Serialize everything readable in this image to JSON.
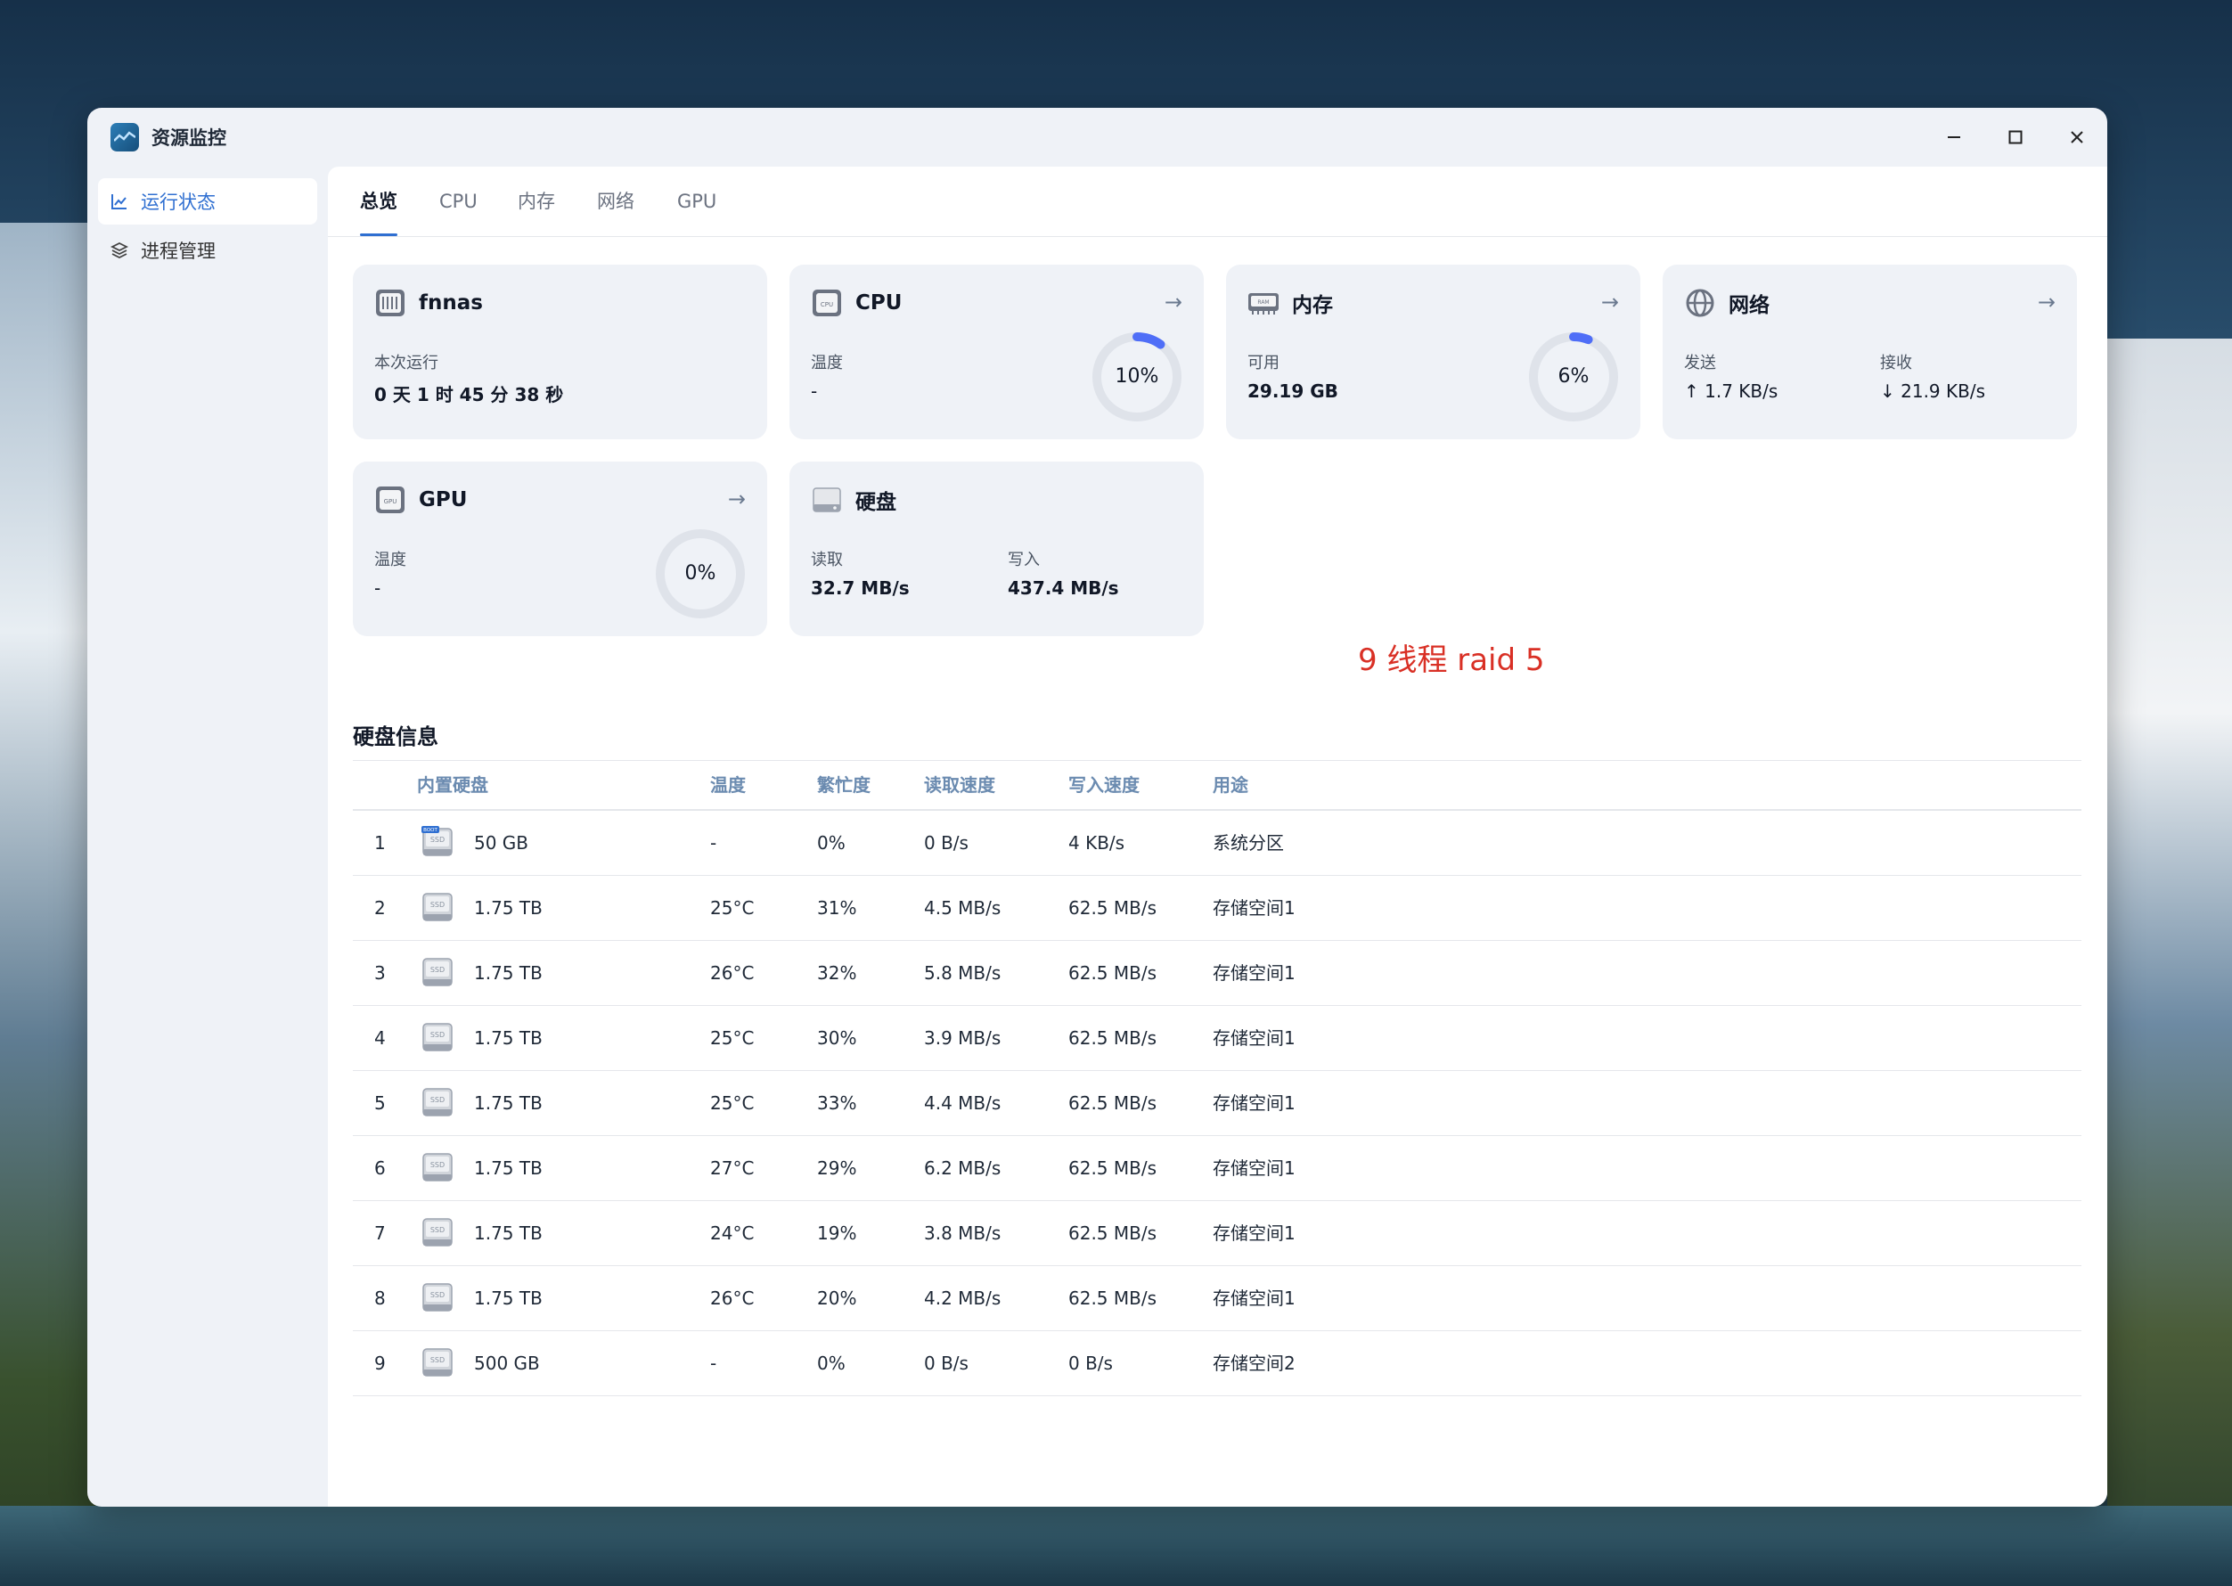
{
  "app": {
    "title": "资源监控"
  },
  "window_controls": {
    "minimize": "—",
    "maximize": "☐",
    "close": "✕"
  },
  "sidebar": {
    "items": [
      {
        "label": "运行状态",
        "active": true,
        "icon": "line-chart-icon"
      },
      {
        "label": "进程管理",
        "active": false,
        "icon": "layers-icon"
      }
    ]
  },
  "tabs": [
    {
      "label": "总览",
      "active": true
    },
    {
      "label": "CPU",
      "active": false
    },
    {
      "label": "内存",
      "active": false
    },
    {
      "label": "网络",
      "active": false
    },
    {
      "label": "GPU",
      "active": false
    }
  ],
  "cards": {
    "system": {
      "title": "fnnas",
      "uptime_label": "本次运行",
      "uptime_value": "0 天 1 时 45 分 38 秒"
    },
    "cpu": {
      "title": "CPU",
      "temp_label": "温度",
      "temp_value": "-",
      "usage_text": "10%",
      "usage": 0.1
    },
    "memory": {
      "title": "内存",
      "avail_label": "可用",
      "avail_value": "29.19 GB",
      "usage_text": "6%",
      "usage": 0.06
    },
    "network": {
      "title": "网络",
      "send_label": "发送",
      "send_value": "↑ 1.7 KB/s",
      "recv_label": "接收",
      "recv_value": "↓ 21.9 KB/s"
    },
    "gpu": {
      "title": "GPU",
      "temp_label": "温度",
      "temp_value": "-",
      "usage_text": "0%",
      "usage": 0.0
    },
    "disk": {
      "title": "硬盘",
      "read_label": "读取",
      "read_value": "32.7 MB/s",
      "write_label": "写入",
      "write_value": "437.4 MB/s"
    }
  },
  "annotation": "9 线程 raid 5",
  "disk_info": {
    "title": "硬盘信息",
    "columns": [
      "内置硬盘",
      "温度",
      "繁忙度",
      "读取速度",
      "写入速度",
      "用途"
    ],
    "rows": [
      {
        "num": "1",
        "badge": "BOOT",
        "size": "50 GB",
        "temp": "-",
        "busy": "0%",
        "read": "0 B/s",
        "write": "4 KB/s",
        "use": "系统分区"
      },
      {
        "num": "2",
        "size": "1.75 TB",
        "temp": "25°C",
        "busy": "31%",
        "read": "4.5 MB/s",
        "write": "62.5 MB/s",
        "use": "存储空间1"
      },
      {
        "num": "3",
        "size": "1.75 TB",
        "temp": "26°C",
        "busy": "32%",
        "read": "5.8 MB/s",
        "write": "62.5 MB/s",
        "use": "存储空间1"
      },
      {
        "num": "4",
        "size": "1.75 TB",
        "temp": "25°C",
        "busy": "30%",
        "read": "3.9 MB/s",
        "write": "62.5 MB/s",
        "use": "存储空间1"
      },
      {
        "num": "5",
        "size": "1.75 TB",
        "temp": "25°C",
        "busy": "33%",
        "read": "4.4 MB/s",
        "write": "62.5 MB/s",
        "use": "存储空间1"
      },
      {
        "num": "6",
        "size": "1.75 TB",
        "temp": "27°C",
        "busy": "29%",
        "read": "6.2 MB/s",
        "write": "62.5 MB/s",
        "use": "存储空间1"
      },
      {
        "num": "7",
        "size": "1.75 TB",
        "temp": "24°C",
        "busy": "19%",
        "read": "3.8 MB/s",
        "write": "62.5 MB/s",
        "use": "存储空间1"
      },
      {
        "num": "8",
        "size": "1.75 TB",
        "temp": "26°C",
        "busy": "20%",
        "read": "4.2 MB/s",
        "write": "62.5 MB/s",
        "use": "存储空间1"
      },
      {
        "num": "9",
        "size": "500 GB",
        "temp": "-",
        "busy": "0%",
        "read": "0 B/s",
        "write": "0 B/s",
        "use": "存储空间2"
      }
    ]
  },
  "colors": {
    "accent": "#2f6fd1",
    "gauge_arc": "#4f6ef7",
    "annotation": "#d93025"
  }
}
